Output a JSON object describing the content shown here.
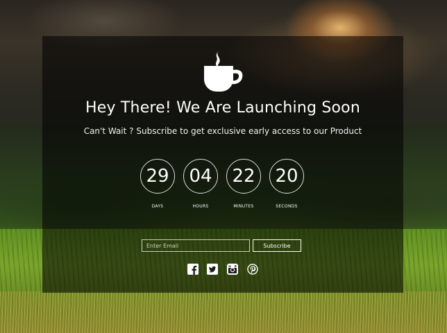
{
  "hero": {
    "title": "Hey There! We Are Launching Soon",
    "subtitle": "Can't Wait ? Subscribe to get exclusive early access to our Product"
  },
  "countdown": [
    {
      "value": "29",
      "label": "DAYS"
    },
    {
      "value": "04",
      "label": "HOURS"
    },
    {
      "value": "22",
      "label": "MINUTES"
    },
    {
      "value": "20",
      "label": "SECONDS"
    }
  ],
  "subscribe_form": {
    "email_placeholder": "Enter Email",
    "button_label": "Subscribe"
  },
  "icons": {
    "logo": "coffee-cup-icon",
    "social": [
      "facebook-icon",
      "twitter-icon",
      "instagram-icon",
      "pinterest-icon"
    ]
  },
  "colors": {
    "text": "#ffffff",
    "overlay": "rgba(0,0,0,0.55)"
  }
}
